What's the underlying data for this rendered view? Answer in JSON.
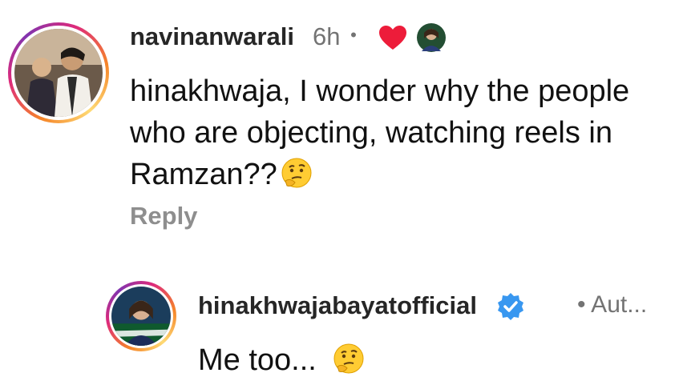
{
  "comment": {
    "username": "navinanwarali",
    "time": "6h",
    "separator": "•",
    "text": "hinakhwaja, I wonder why the people who are objecting, watching reels in Ramzan??",
    "emoji": "thinking-face-icon",
    "liked_by_creator": true,
    "reply_label": "Reply"
  },
  "reply": {
    "username": "hinakhwajabayatofficial",
    "verified": true,
    "author_badge": "• Aut...",
    "text": "Me too...",
    "emoji": "thinking-face-icon"
  },
  "colors": {
    "heart": "#ed1c3a",
    "verified": "#3897f0",
    "muted": "#8e8e8e",
    "username": "#262626"
  }
}
